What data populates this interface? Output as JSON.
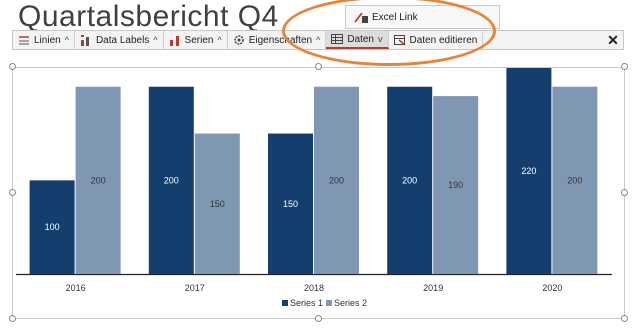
{
  "slide": {
    "title": "Quartalsbericht Q4"
  },
  "toolbar": {
    "items": [
      {
        "label": "Linien",
        "icon": "lines-icon"
      },
      {
        "label": "Data Labels",
        "icon": "data-labels-icon"
      },
      {
        "label": "Serien",
        "icon": "series-icon"
      },
      {
        "label": "Eigenschaften",
        "icon": "gear-icon"
      },
      {
        "label": "Daten",
        "icon": "table-icon"
      },
      {
        "label": "Daten editieren",
        "icon": "edit-data-icon"
      }
    ],
    "close_label": "✕",
    "active_item": "Daten",
    "accent_color": "#c0392b"
  },
  "dropdown": {
    "item_label": "Excel Link",
    "icon": "excel-link-icon"
  },
  "annotation": {
    "color": "#e8843a",
    "shape": "ellipse"
  },
  "chart_data": {
    "type": "bar",
    "categories": [
      "2016",
      "2017",
      "2018",
      "2019",
      "2020"
    ],
    "series": [
      {
        "name": "Series 1",
        "values": [
          100,
          200,
          150,
          200,
          220
        ],
        "color": "#143e6e"
      },
      {
        "name": "Series 2",
        "values": [
          200,
          150,
          200,
          190,
          200
        ],
        "color": "#8097b4"
      }
    ],
    "ylim": [
      0,
      220
    ],
    "grid": false,
    "data_labels": true,
    "legend_position": "bottom"
  }
}
